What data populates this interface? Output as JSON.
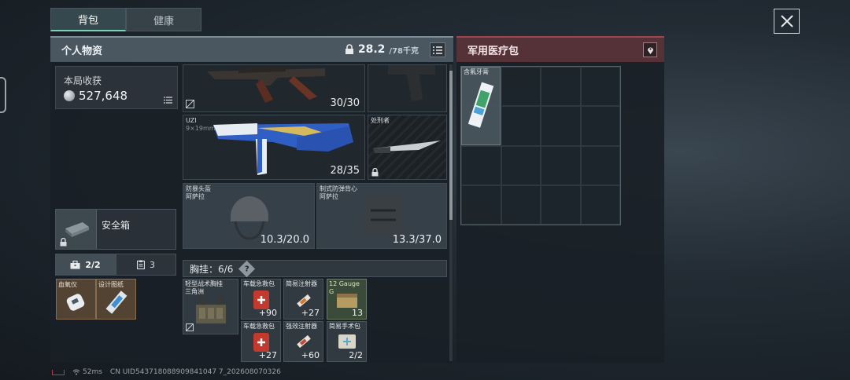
{
  "tabs": [
    {
      "label": "背包"
    },
    {
      "label": "健康"
    }
  ],
  "inventory": {
    "title": "个人物资",
    "weight_current": "28.2",
    "weight_max": "/78千克",
    "earnings": {
      "label": "本局收获",
      "value": "527,648"
    },
    "safebox_label": "安全箱",
    "bag_tabs": [
      {
        "label": "2/2"
      },
      {
        "label": "3"
      }
    ],
    "tools": [
      {
        "label": "血氧仪"
      },
      {
        "label": "设计图纸"
      }
    ],
    "weapons": [
      {
        "name": "",
        "count": "30/30"
      },
      {
        "name": "UZI",
        "sub": "9×19mm",
        "count": "28/35"
      },
      {
        "name": "处刑者"
      }
    ],
    "armor": [
      {
        "name": "防暴头盔",
        "brand": "阿萨拉",
        "count": "10.3/20.0"
      },
      {
        "name": "制式防弹背心",
        "brand": "阿萨拉",
        "count": "13.3/37.0"
      }
    ],
    "chest": {
      "label": "胸挂：",
      "value": "6/6",
      "rig_name": "轻型战术胸挂",
      "rig_sub": "三角洲",
      "items": [
        {
          "name": "车载急救包",
          "count": "+90"
        },
        {
          "name": "简易注射器",
          "count": "+27"
        },
        {
          "name": "12 Gauge",
          "sub": "G",
          "count": "13"
        },
        {
          "name": "车载急救包",
          "count": "+27"
        },
        {
          "name": "强效注射器",
          "count": "+60"
        },
        {
          "name": "简易手术包",
          "count": "2/2"
        }
      ]
    }
  },
  "medical": {
    "title": "军用医疗包",
    "items": [
      {
        "name": "含氟牙膏"
      }
    ]
  },
  "status": {
    "ping": "52ms",
    "uid": "CN UID543718088909841047 7_202608070326"
  }
}
